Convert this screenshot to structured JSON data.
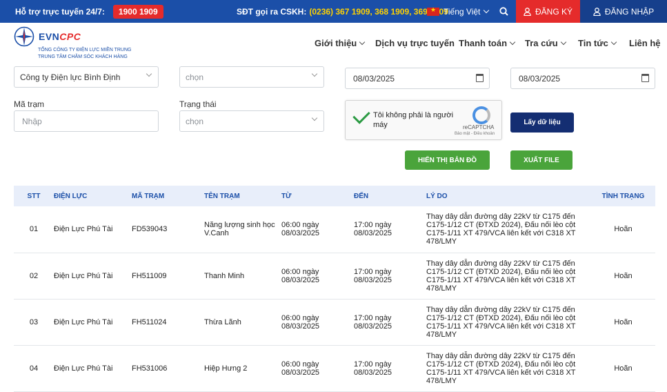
{
  "topbar": {
    "support_label": "Hỗ trợ trực tuyến 24/7:",
    "hotline": "1900 1909",
    "cskh_label": "SĐT gọi ra CSKH:",
    "cskh_numbers": "(0236) 367 1909, 368 1909, 369 1909",
    "language": "Tiếng Việt",
    "register_label": "ĐĂNG KÝ",
    "login_label": "ĐĂNG NHẬP",
    "accent": "#1b4fa8",
    "red": "#e52b2b"
  },
  "header": {
    "logo_text_evn": "EVN",
    "logo_text_cpc": "CPC",
    "logo_sub1": "TỔNG CÔNG TY ĐIỆN LỰC MIỀN TRUNG",
    "logo_sub2": "TRUNG TÂM CHĂM SÓC KHÁCH HÀNG",
    "nav": [
      "Giới thiệu",
      "Dịch vụ trực tuyến",
      "Thanh toán",
      "Tra cứu",
      "Tin tức",
      "Liên hệ"
    ]
  },
  "filters": {
    "company": "Công ty Điện lực Bình Định",
    "unit_placeholder": "chọn",
    "from_date": "08/03/2025",
    "to_date": "08/03/2025",
    "station_label": "Mã trạm",
    "station_placeholder": "Nhập",
    "status_label": "Trạng thái",
    "status_placeholder": "chọn",
    "captcha_text": "Tôi không phải là người máy",
    "captcha_brand": "reCAPTCHA",
    "captcha_terms": "Bảo mật - Điều khoản",
    "fetch_button": "Lấy dữ liệu",
    "map_button": "HIỂN THỊ BẢN ĐỒ",
    "export_button": "XUẤT FILE"
  },
  "table": {
    "headers": [
      "STT",
      "ĐIỆN LỰC",
      "MÃ TRẠM",
      "TÊN TRẠM",
      "TỪ",
      "ĐẾN",
      "LÝ DO",
      "TÌNH TRẠNG"
    ],
    "rows": [
      {
        "stt": "01",
        "dien_luc": "Điện Lực Phú Tài",
        "ma_tram": "FD539043",
        "ten_tram": "Năng lượng sinh học V.Canh",
        "tu": "06:00 ngày 08/03/2025",
        "den": "17:00 ngày 08/03/2025",
        "ly_do": "Thay dây dẫn đường dây 22kV từ C175 đến C175-1/12 CT (ĐTXD 2024), Đấu nối lèo cột C175-1/11 XT 479/VCA liên kết với C318 XT 478/LMY",
        "tinh_trang": "Hoãn"
      },
      {
        "stt": "02",
        "dien_luc": "Điện Lực Phú Tài",
        "ma_tram": "FH511009",
        "ten_tram": "Thanh Minh",
        "tu": "06:00 ngày 08/03/2025",
        "den": "17:00 ngày 08/03/2025",
        "ly_do": "Thay dây dẫn đường dây 22kV từ C175 đến C175-1/12 CT (ĐTXD 2024), Đấu nối lèo cột C175-1/11 XT 479/VCA liên kết với C318 XT 478/LMY",
        "tinh_trang": "Hoãn"
      },
      {
        "stt": "03",
        "dien_luc": "Điện Lực Phú Tài",
        "ma_tram": "FH511024",
        "ten_tram": "Thừa Lãnh",
        "tu": "06:00 ngày 08/03/2025",
        "den": "17:00 ngày 08/03/2025",
        "ly_do": "Thay dây dẫn đường dây 22kV từ C175 đến C175-1/12 CT (ĐTXD 2024), Đấu nối lèo cột C175-1/11 XT 479/VCA liên kết với C318 XT 478/LMY",
        "tinh_trang": "Hoãn"
      },
      {
        "stt": "04",
        "dien_luc": "Điện Lực Phú Tài",
        "ma_tram": "FH531006",
        "ten_tram": "Hiệp Hưng 2",
        "tu": "06:00 ngày 08/03/2025",
        "den": "17:00 ngày 08/03/2025",
        "ly_do": "Thay dây dẫn đường dây 22kV từ C175 đến C175-1/12 CT (ĐTXD 2024), Đấu nối lèo cột C175-1/11 XT 479/VCA liên kết với C318 XT 478/LMY",
        "tinh_trang": "Hoãn"
      }
    ]
  }
}
